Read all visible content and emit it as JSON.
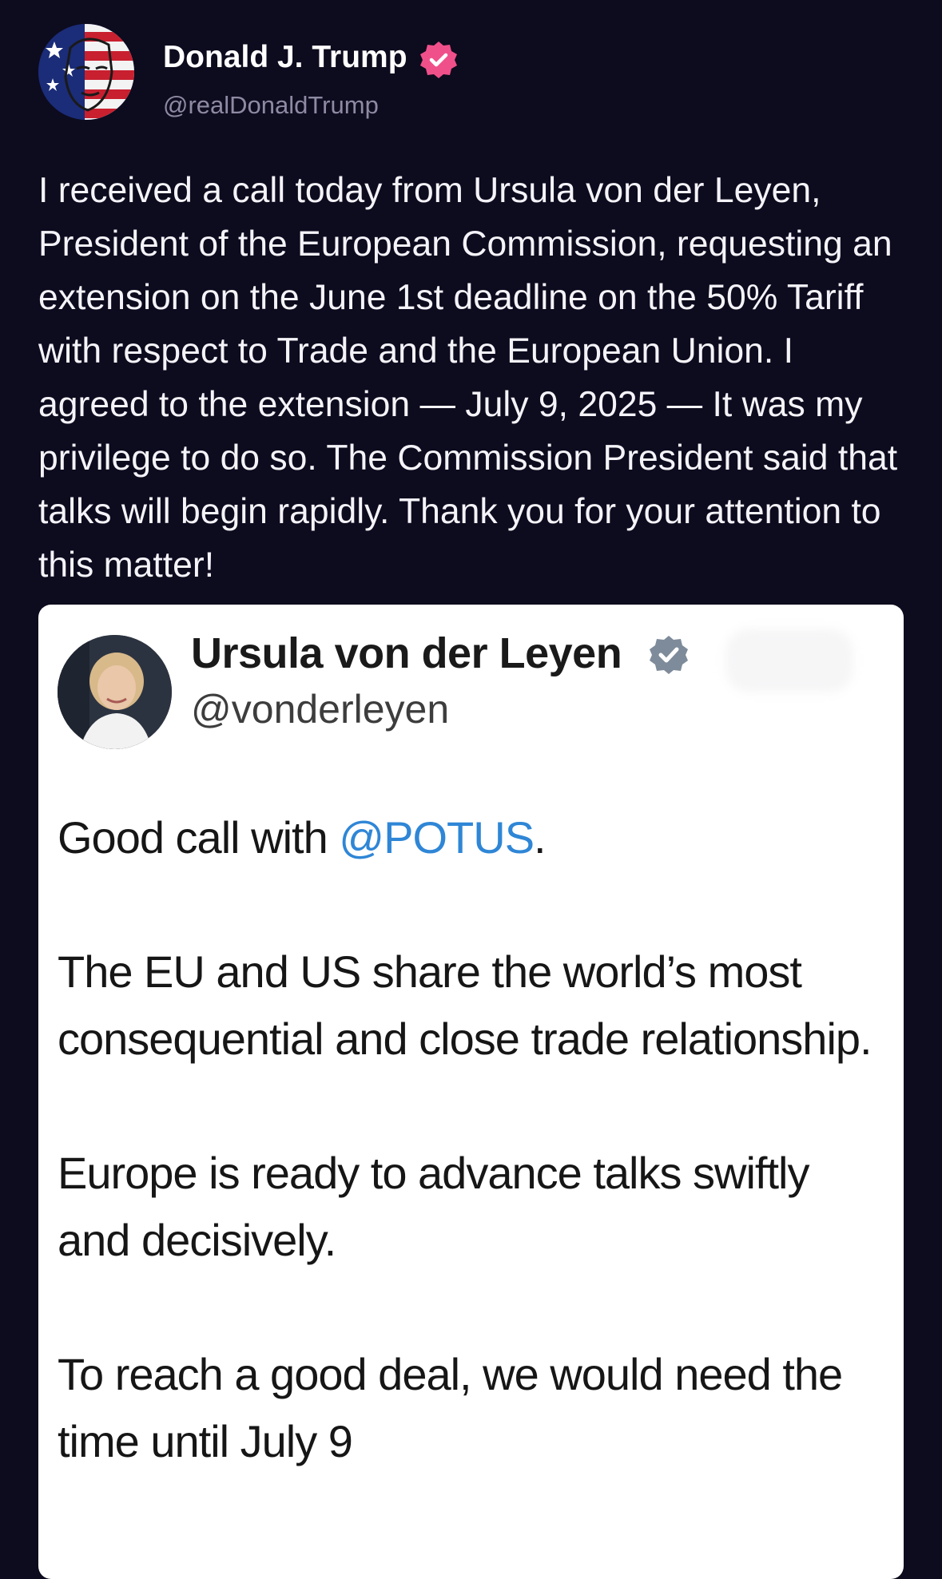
{
  "post": {
    "author": {
      "name": "Donald J. Trump",
      "handle": "@realDonaldTrump",
      "verified": true,
      "badge_color": "#f0508a"
    },
    "text": "I received a call today from Ursula von der Leyen, President of the European Commission, requesting an extension on the June 1st deadline on the 50% Tariff with respect to Trade and the European Union. I agreed to the extension — July 9, 2025 — It was my privilege to do so. The Commission President said that talks will begin rapidly. Thank you for your attention to this matter!"
  },
  "quote": {
    "author": {
      "name": "Ursula von der Leyen",
      "handle": "@vonderleyen",
      "verified": true,
      "badge_color": "#7e8b9a"
    },
    "paragraphs": {
      "p1_prefix": "Good call with ",
      "p1_mention": "@POTUS",
      "p1_suffix": ".",
      "p2": "The EU and US share the world’s most consequential and close trade relationship.",
      "p3": "Europe is ready to advance talks swiftly and decisively.",
      "p4": "To reach a good deal, we would need the time until July 9"
    },
    "mention_color": "#2f86d6"
  },
  "theme": {
    "background": "#0d0b1e",
    "card_background": "#ffffff"
  }
}
